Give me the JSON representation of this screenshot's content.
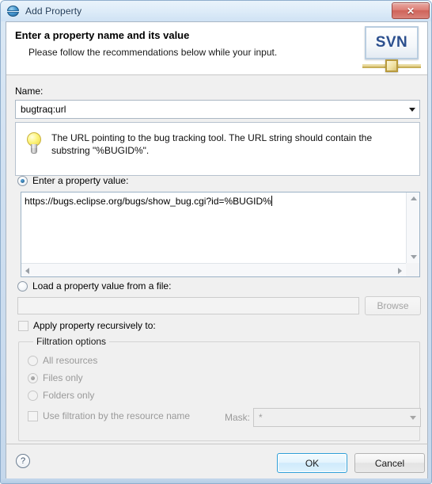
{
  "window": {
    "title": "Add Property",
    "icon": "svn-sphere-icon",
    "close_label": "×"
  },
  "banner": {
    "title": "Enter a property name and its value",
    "subtitle": "Please follow the recommendations below while your input.",
    "logo_text": "SVN"
  },
  "name_section": {
    "label": "Name:",
    "value": "bugtraq:url",
    "placeholder": ""
  },
  "tip": {
    "icon": "lightbulb-icon",
    "text": "The URL pointing to the bug tracking tool. The URL string should contain the substring \"%BUGID%\"."
  },
  "value_section": {
    "radio_label": "Enter a property value:",
    "radio_selected": true,
    "value": "https://bugs.eclipse.org/bugs/show_bug.cgi?id=%BUGID%"
  },
  "file_section": {
    "radio_label": "Load a property value from a file:",
    "radio_selected": false,
    "path_value": "",
    "path_placeholder": "",
    "browse_label": "Browse",
    "browse_enabled": false
  },
  "recursive": {
    "checkbox_label": "Apply property recursively to:",
    "checked": false
  },
  "filtration": {
    "group_title": "Filtration options",
    "options": [
      {
        "label": "All resources",
        "selected": false
      },
      {
        "label": "Files only",
        "selected": true
      },
      {
        "label": "Folders only",
        "selected": false
      }
    ],
    "use_filtration_label": "Use filtration by the resource name",
    "use_filtration_checked": false,
    "mask_label": "Mask:",
    "mask_value": "*"
  },
  "footer": {
    "help_label": "?",
    "ok_label": "OK",
    "cancel_label": "Cancel"
  }
}
